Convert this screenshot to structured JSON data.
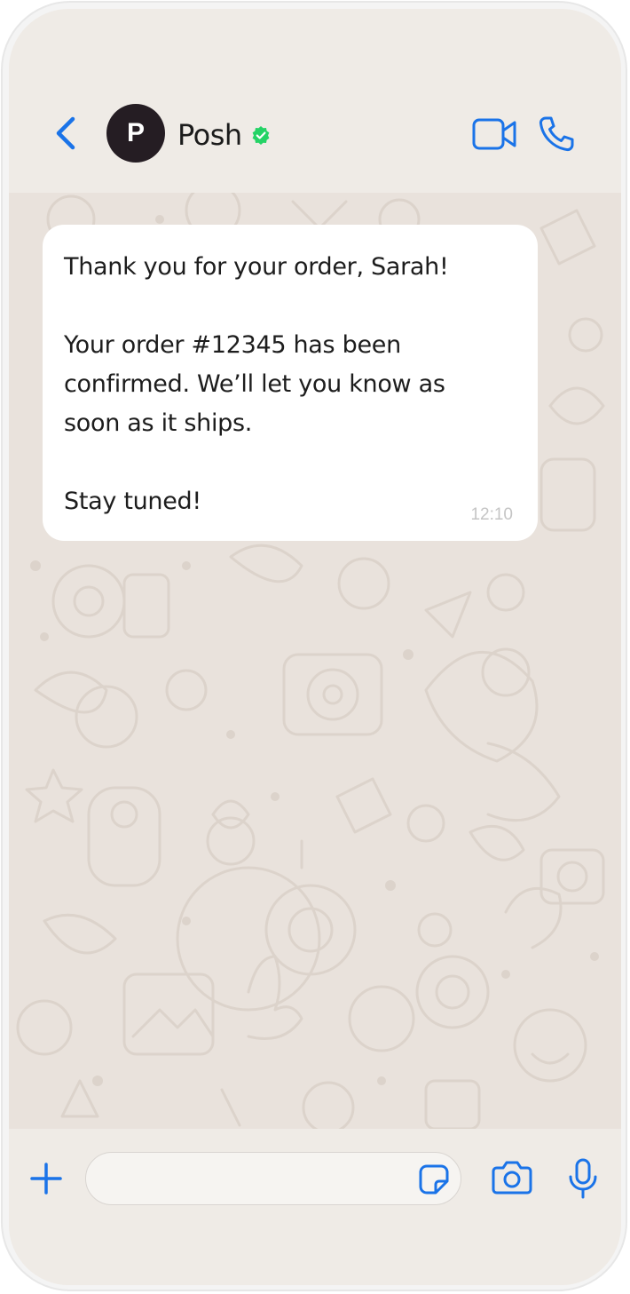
{
  "header": {
    "contact_name": "Posh",
    "avatar_letter": "P",
    "icons": {
      "back": "chevron-left-icon",
      "verified": "verified-badge-icon",
      "video": "video-camera-icon",
      "call": "phone-icon"
    }
  },
  "chat": {
    "messages": [
      {
        "direction": "incoming",
        "line1": "Thank you for your order, Sarah!",
        "line2": "Your order #12345 has been\nconfirmed. We’ll let you know as\nsoon as it ships.",
        "line3": "Stay tuned!",
        "time": "12:10"
      }
    ]
  },
  "input_bar": {
    "message_value": "",
    "icons": {
      "attach": "plus-icon",
      "sticker": "sticker-icon",
      "camera": "camera-icon",
      "mic": "microphone-icon"
    }
  },
  "colors": {
    "accent": "#1a73e8",
    "verified": "#25d366",
    "header_bg": "#efebe6",
    "chat_bg": "#e9e2dc",
    "bubble_bg": "#ffffff",
    "avatar_bg": "#251d23"
  }
}
